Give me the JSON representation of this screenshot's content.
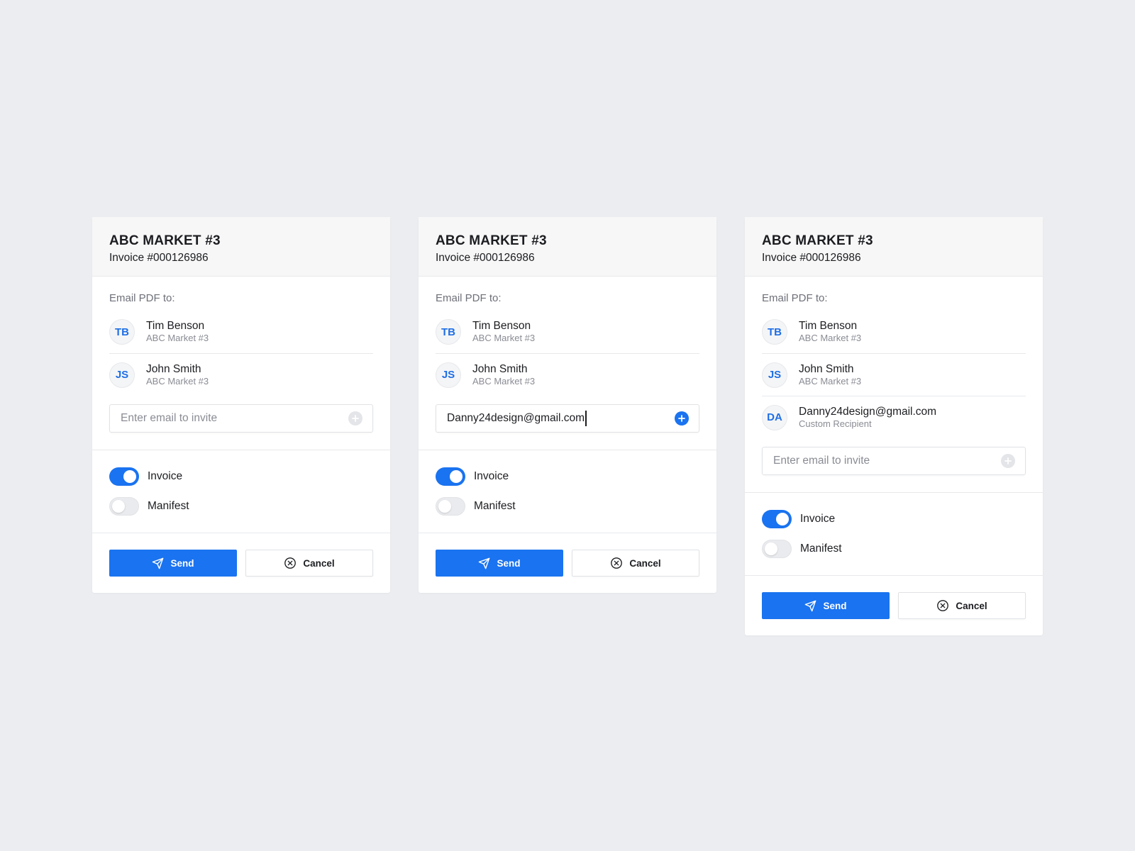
{
  "colors": {
    "accent": "#1a73f0",
    "background": "#ecedf0",
    "card": "#ffffff",
    "header": "#f7f7f7"
  },
  "cards": [
    {
      "title": "ABC MARKET #3",
      "subtitle": "Invoice #000126986",
      "email_label": "Email PDF to:",
      "recipients": [
        {
          "initials": "TB",
          "name": "Tim Benson",
          "sub": "ABC Market #3"
        },
        {
          "initials": "JS",
          "name": "John Smith",
          "sub": "ABC Market #3"
        }
      ],
      "invite": {
        "placeholder": "Enter email to invite",
        "value": "",
        "icon": "plus-circle-icon"
      },
      "toggles": [
        {
          "label": "Invoice",
          "on": true
        },
        {
          "label": "Manifest",
          "on": false
        }
      ],
      "send_label": "Send",
      "cancel_label": "Cancel"
    },
    {
      "title": "ABC MARKET #3",
      "subtitle": "Invoice #000126986",
      "email_label": "Email PDF to:",
      "recipients": [
        {
          "initials": "TB",
          "name": "Tim Benson",
          "sub": "ABC Market #3"
        },
        {
          "initials": "JS",
          "name": "John Smith",
          "sub": "ABC Market #3"
        }
      ],
      "invite": {
        "placeholder": "Enter email to invite",
        "value": "Danny24design@gmail.com",
        "icon": "plus-circle-icon"
      },
      "toggles": [
        {
          "label": "Invoice",
          "on": true
        },
        {
          "label": "Manifest",
          "on": false
        }
      ],
      "send_label": "Send",
      "cancel_label": "Cancel"
    },
    {
      "title": "ABC MARKET #3",
      "subtitle": "Invoice #000126986",
      "email_label": "Email PDF to:",
      "recipients": [
        {
          "initials": "TB",
          "name": "Tim Benson",
          "sub": "ABC Market #3"
        },
        {
          "initials": "JS",
          "name": "John Smith",
          "sub": "ABC Market #3"
        },
        {
          "initials": "DA",
          "name": "Danny24design@gmail.com",
          "sub": "Custom Recipient"
        }
      ],
      "invite": {
        "placeholder": "Enter email to invite",
        "value": "",
        "icon": "plus-circle-icon"
      },
      "toggles": [
        {
          "label": "Invoice",
          "on": true
        },
        {
          "label": "Manifest",
          "on": false
        }
      ],
      "send_label": "Send",
      "cancel_label": "Cancel"
    }
  ]
}
